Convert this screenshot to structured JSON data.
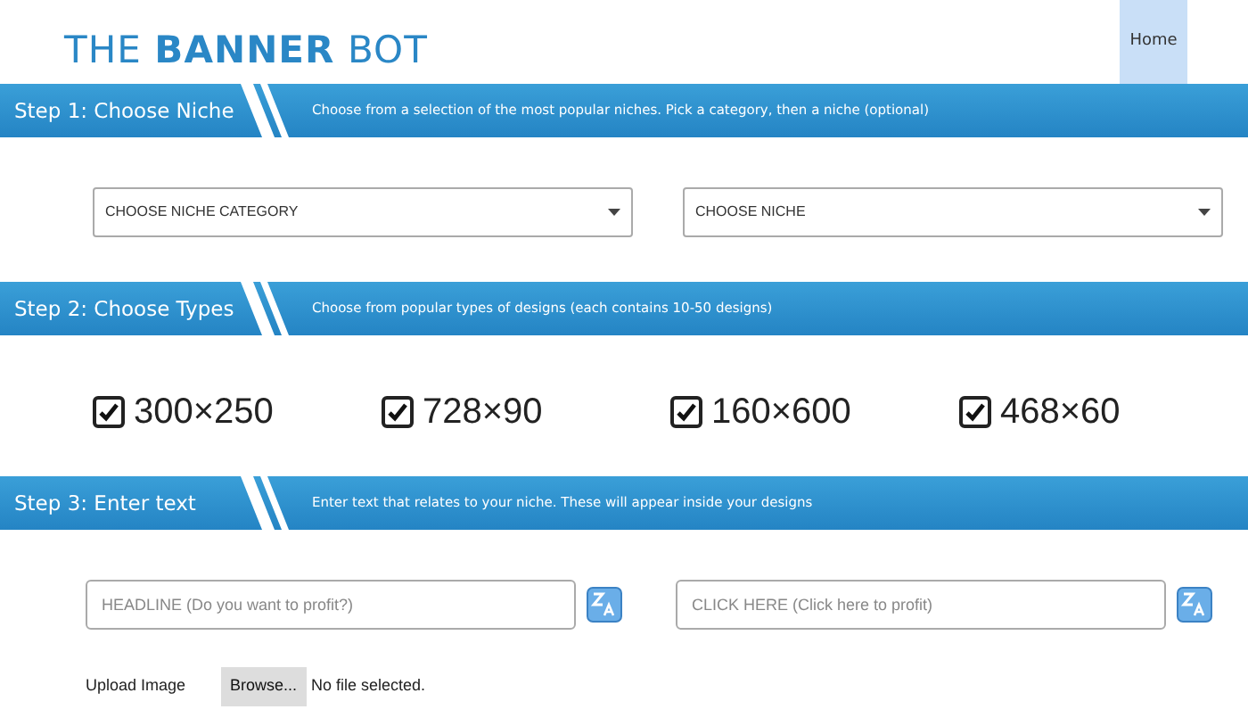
{
  "logo": "THE **BANNER** BOT",
  "nav": [
    {
      "label": "Home",
      "selected": true
    }
  ],
  "step1": {
    "title": "Step 1: Choose Niche",
    "description": "Choose from a selection of the most popular niches. Pick a category, then a niche (optional)",
    "selects": [
      "CHOOSE NICHE CATEGORY",
      "CHOOSE NICHE"
    ]
  },
  "step2": {
    "title": "Step 2: Choose Types",
    "description": "Choose from popular types of designs (each contains 10-50 designs)",
    "types": [
      {
        "label": "300×250",
        "checked": true
      },
      {
        "label": "728×90",
        "checked": true
      },
      {
        "label": "160×600",
        "checked": true
      },
      {
        "label": "468×60",
        "checked": true
      }
    ]
  },
  "step3": {
    "title": "Step 3: Enter text",
    "description": "Enter text that relates to your niche. These will appear inside your designs",
    "fields": [
      {
        "placeholder": "HEADLINE (Do you want to profit?)"
      },
      {
        "placeholder": "CLICK HERE (Click here to profit)"
      }
    ],
    "upload": {
      "label": "Upload Image",
      "button": "Browse...",
      "status": "No file selected."
    }
  }
}
